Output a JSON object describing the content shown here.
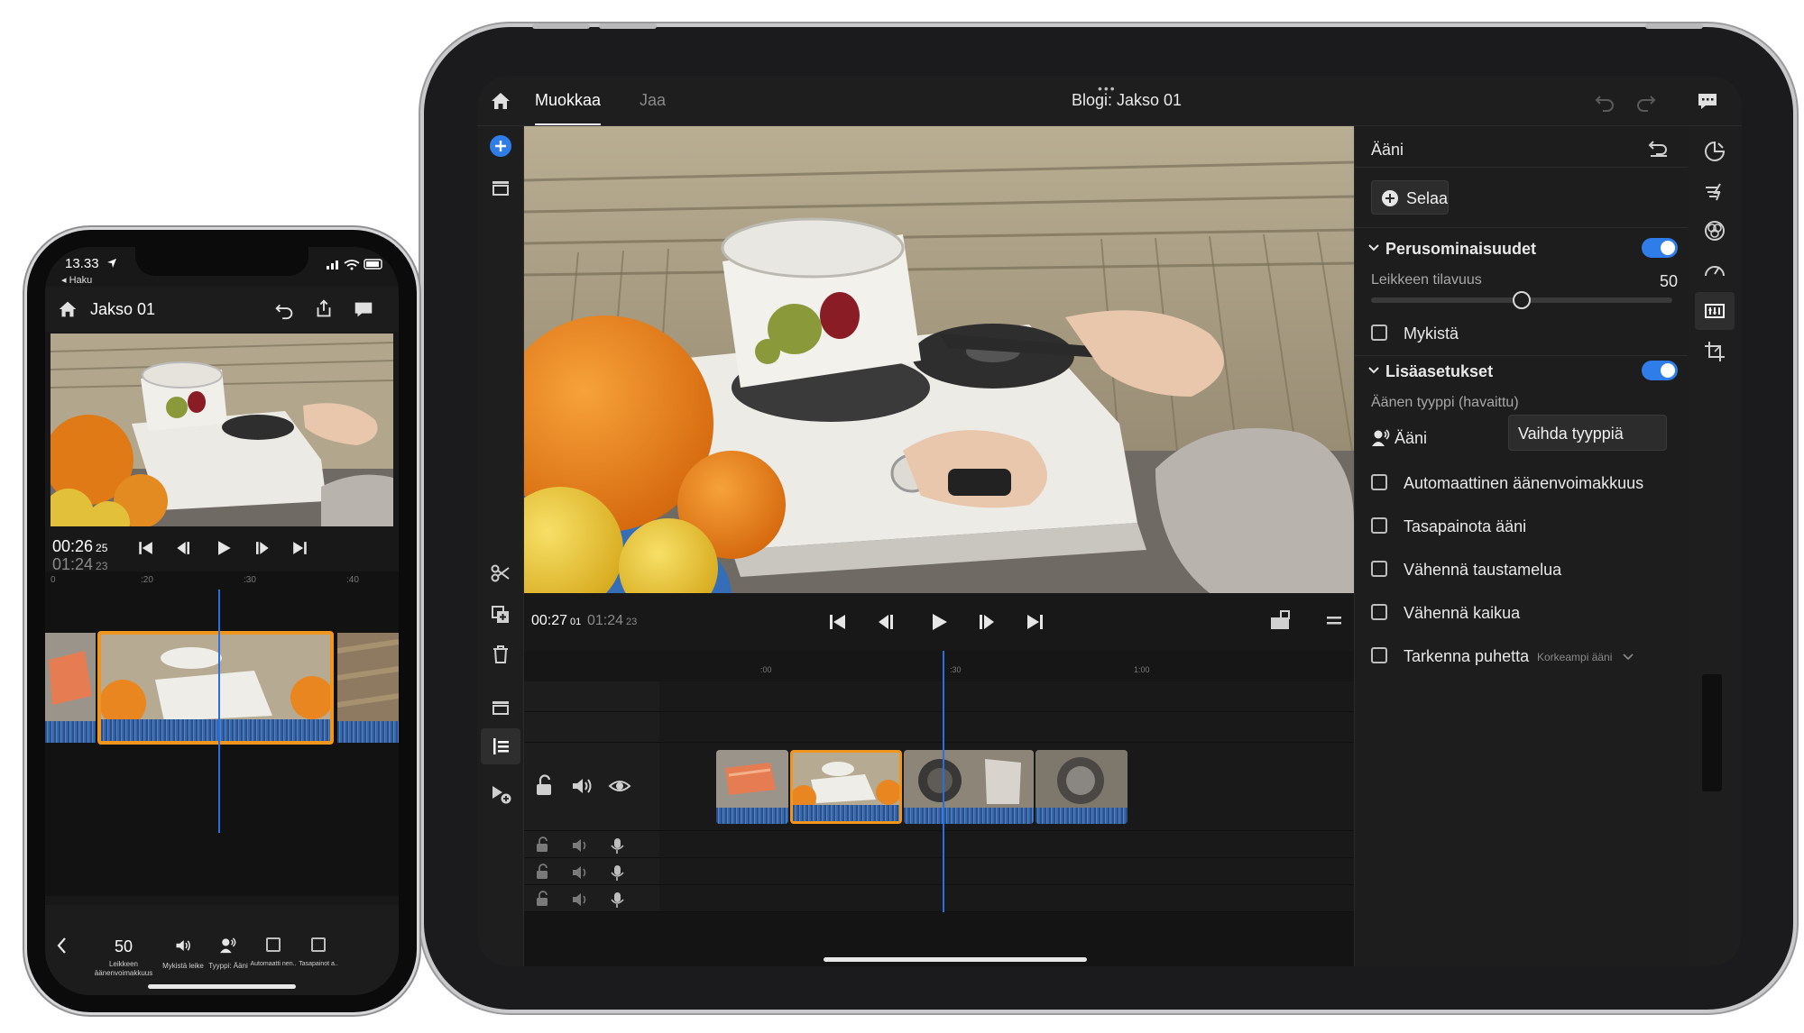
{
  "tablet": {
    "topbar": {
      "tab_edit": "Muokkaa",
      "tab_share": "Jaa",
      "project_title": "Blogi: Jakso 01"
    },
    "transport": {
      "current_time": "00:27",
      "current_frames": "01",
      "total_time": "01:24",
      "total_frames": "23"
    },
    "ruler_ticks": [
      ":00",
      ":30",
      "1:00"
    ],
    "panel": {
      "title": "Ääni",
      "browse_button": "Selaa",
      "basic_section": "Perusominaisuudet",
      "clip_volume_label": "Leikkeen tilavuus",
      "clip_volume_value": "50",
      "clip_volume_fraction": 0.5,
      "mute_label": "Mykistä",
      "advanced_section": "Lisäasetukset",
      "audio_type_label": "Äänen tyyppi (havaittu)",
      "audio_type_value": "Ääni",
      "change_type_button": "Vaihda tyyppiä",
      "options": [
        "Automaattinen äänenvoimakkuus",
        "Tasapainota ääni",
        "Vähennä taustamelua",
        "Vähennä kaikua"
      ],
      "enhance_speech_label": "Tarkenna puhetta",
      "enhance_speech_value": "Korkeampi ääni"
    },
    "colors": {
      "accent_blue": "#2f7de8",
      "clip_selected_border": "#f0961e",
      "playhead": "#2a6fe0"
    }
  },
  "phone": {
    "status_time": "13.33",
    "back_label": "◂ Haku",
    "project_title": "Jakso 01",
    "current_time": "00:26",
    "current_frames": "25",
    "total_time": "01:24",
    "total_frames": "23",
    "ruler_ticks": [
      "0",
      ":20",
      ":30",
      ":40"
    ],
    "toolbar": {
      "volume_value": "50",
      "volume_label": "Leikkeen äänenvoimakkuus",
      "mute_label": "Mykistä leike",
      "type_label": "Tyyppi: Ääni",
      "auto_label": "Automaatti nen..",
      "balance_label": "Tasapainot a.."
    }
  }
}
